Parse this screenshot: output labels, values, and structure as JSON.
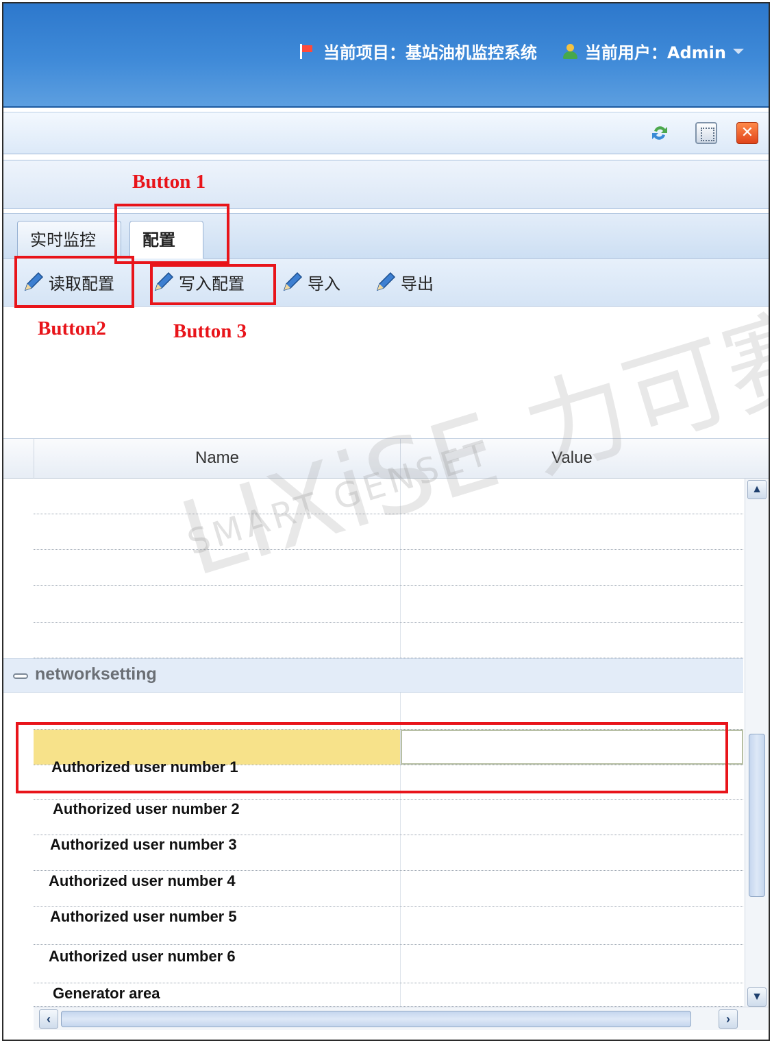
{
  "header": {
    "project_label": "当前项目：基站油机监控系统",
    "user_label": "当前用户：Admin",
    "icons": [
      "flag-icon",
      "user-icon",
      "caret-down-icon"
    ]
  },
  "toolbar": {
    "icons": [
      "refresh-icon",
      "fullscreen-icon",
      "close-icon"
    ],
    "close_glyph": "✕"
  },
  "tabs": [
    {
      "label": "实时监控",
      "active": false
    },
    {
      "label": "配置",
      "active": true
    }
  ],
  "actions": [
    {
      "label": "读取配置",
      "icon": "pencil-icon"
    },
    {
      "label": "写入配置",
      "icon": "pencil-icon"
    },
    {
      "label": "导入",
      "icon": "pencil-icon"
    },
    {
      "label": "导出",
      "icon": "pencil-icon"
    }
  ],
  "annotations": {
    "button1": "Button 1",
    "button2": "Button2",
    "button3": "Button 3"
  },
  "watermark": {
    "main": "LIXiSE 力可赛",
    "sub": "SMART GENSET"
  },
  "grid": {
    "columns": {
      "name": "Name",
      "value": "Value"
    },
    "group": "networksetting",
    "rows": [
      {
        "name": "Authorized user  number 1"
      },
      {
        "name": "Authorized user  number 2"
      },
      {
        "name": "Authorized user  number 3"
      },
      {
        "name": "Authorized user  number 4"
      },
      {
        "name": "Authorized user  number 5"
      },
      {
        "name": "Authorized user  number 6"
      },
      {
        "name": "Generator area"
      }
    ]
  },
  "colors": {
    "header_blue": "#3f8ad8",
    "annotation_red": "#e8141a",
    "selected_row": "#f7e28a"
  }
}
